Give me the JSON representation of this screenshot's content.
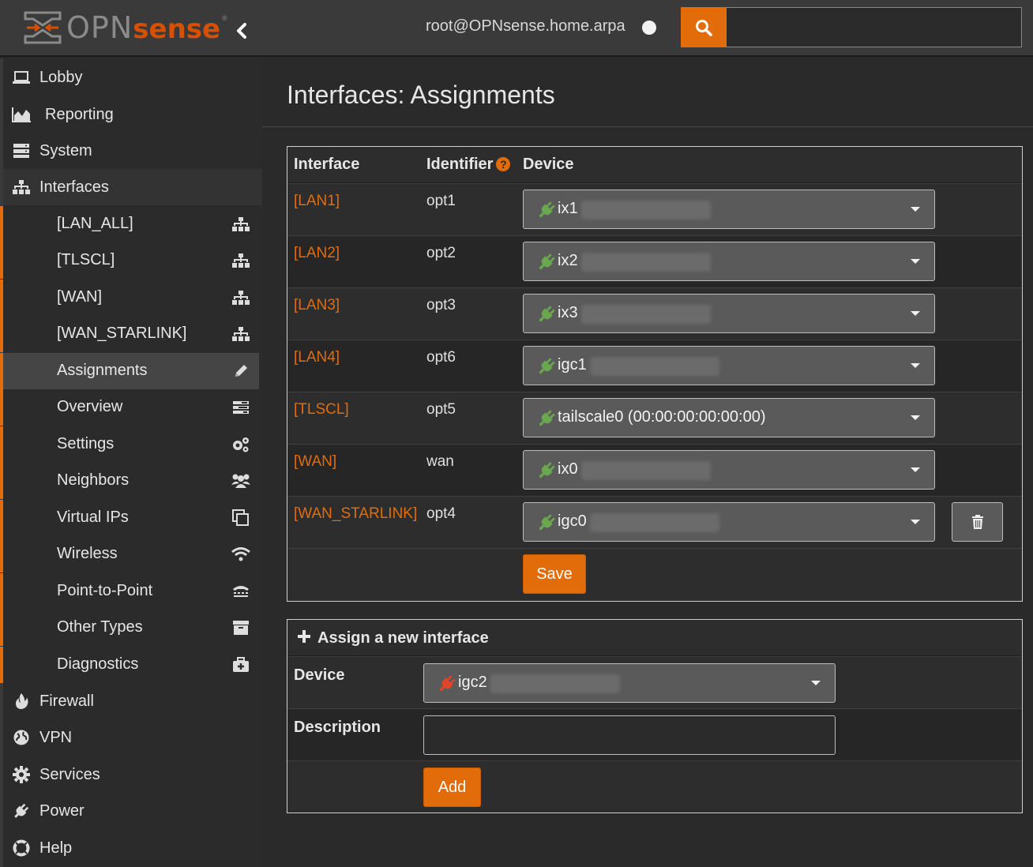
{
  "header": {
    "logo_text_a": "OPN",
    "logo_text_b": "sense",
    "logo_reg": "®",
    "host": "root@OPNsense.home.arpa",
    "search_placeholder": ""
  },
  "sidebar": {
    "items": [
      {
        "label": "Lobby",
        "icon": "laptop-icon"
      },
      {
        "label": "Reporting",
        "icon": "area-chart-icon"
      },
      {
        "label": "System",
        "icon": "server-icon"
      },
      {
        "label": "Interfaces",
        "icon": "sitemap-icon"
      }
    ],
    "interfaces_sub": [
      {
        "label": "[LAN_ALL]",
        "icon": "sitemap-icon"
      },
      {
        "label": "[TLSCL]",
        "icon": "sitemap-icon"
      },
      {
        "label": "[WAN]",
        "icon": "sitemap-icon"
      },
      {
        "label": "[WAN_STARLINK]",
        "icon": "sitemap-icon"
      },
      {
        "label": "Assignments",
        "icon": "pencil-icon"
      },
      {
        "label": "Overview",
        "icon": "tasks-icon"
      },
      {
        "label": "Settings",
        "icon": "cogs-icon"
      },
      {
        "label": "Neighbors",
        "icon": "users-icon"
      },
      {
        "label": "Virtual IPs",
        "icon": "clone-icon"
      },
      {
        "label": "Wireless",
        "icon": "wifi-icon"
      },
      {
        "label": "Point-to-Point",
        "icon": "tty-icon"
      },
      {
        "label": "Other Types",
        "icon": "archive-icon"
      },
      {
        "label": "Diagnostics",
        "icon": "medkit-icon"
      }
    ],
    "items_bottom": [
      {
        "label": "Firewall",
        "icon": "fire-icon"
      },
      {
        "label": "VPN",
        "icon": "globe-icon"
      },
      {
        "label": "Services",
        "icon": "cog-icon"
      },
      {
        "label": "Power",
        "icon": "plug-icon"
      },
      {
        "label": "Help",
        "icon": "life-ring-icon"
      }
    ]
  },
  "main": {
    "title": "Interfaces: Assignments",
    "table": {
      "headers": {
        "interface": "Interface",
        "identifier": "Identifier",
        "help": "?",
        "device": "Device"
      },
      "rows": [
        {
          "interface": "[LAN1]",
          "identifier": "opt1",
          "device": "ix1"
        },
        {
          "interface": "[LAN2]",
          "identifier": "opt2",
          "device": "ix2"
        },
        {
          "interface": "[LAN3]",
          "identifier": "opt3",
          "device": "ix3"
        },
        {
          "interface": "[LAN4]",
          "identifier": "opt6",
          "device": "igc1"
        },
        {
          "interface": "[TLSCL]",
          "identifier": "opt5",
          "device": "tailscale0 (00:00:00:00:00:00)"
        },
        {
          "interface": "[WAN]",
          "identifier": "wan",
          "device": "ix0"
        },
        {
          "interface": "[WAN_STARLINK]",
          "identifier": "opt4",
          "device": "igc0"
        }
      ],
      "save_label": "Save"
    },
    "assign": {
      "title": "Assign a new interface",
      "device_label": "Device",
      "device_value": "igc2",
      "description_label": "Description",
      "description_value": "",
      "add_label": "Add"
    }
  },
  "colors": {
    "accent": "#e36c0a",
    "plug_up": "#6aa84f",
    "plug_down": "#e0442b"
  }
}
